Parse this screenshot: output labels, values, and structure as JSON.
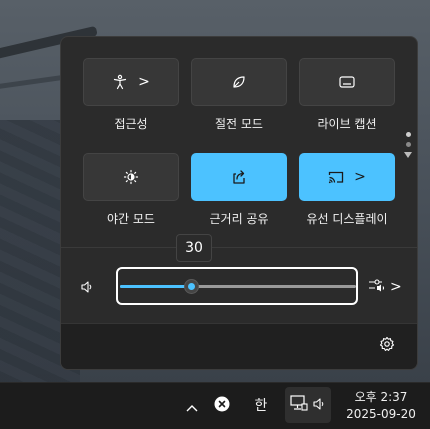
{
  "tiles": [
    {
      "label": "접근성",
      "icon": "accessibility-icon",
      "active": false,
      "has_arrow": true
    },
    {
      "label": "절전 모드",
      "icon": "energy-saver-leaf-icon",
      "active": false,
      "has_arrow": false
    },
    {
      "label": "라이브 캡션",
      "icon": "live-captions-icon",
      "active": false,
      "has_arrow": false
    },
    {
      "label": "야간 모드",
      "icon": "night-light-icon",
      "active": false,
      "has_arrow": false
    },
    {
      "label": "근거리 공유",
      "icon": "nearby-share-icon",
      "active": true,
      "has_arrow": false
    },
    {
      "label": "유선 디스플레이",
      "icon": "cast-icon",
      "active": true,
      "has_arrow": true
    }
  ],
  "chevron": ">",
  "volume": {
    "value_label": "30",
    "level": 30
  },
  "taskbar": {
    "ime": "한",
    "time": "오후 2:37",
    "date": "2025-09-20"
  },
  "colors": {
    "accent": "#4cc2ff",
    "panel": "#2b2b2b",
    "taskbar": "#1c1c1c"
  }
}
